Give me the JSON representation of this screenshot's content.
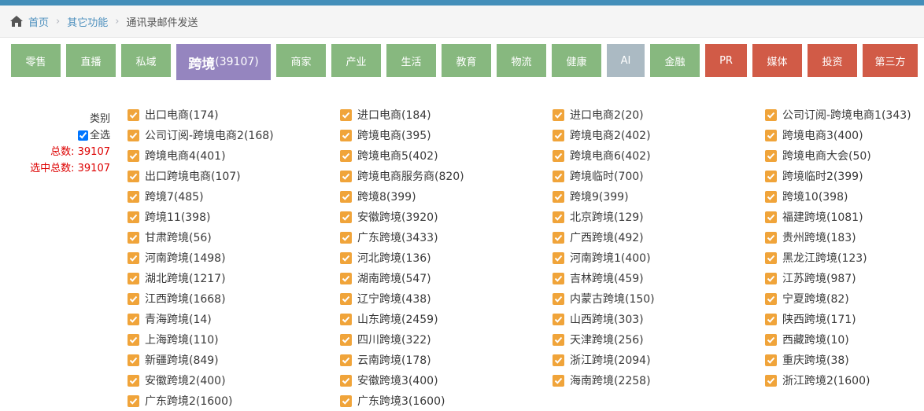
{
  "breadcrumb": {
    "home": "首页",
    "level1": "其它功能",
    "current": "通讯录邮件发送"
  },
  "colors": {
    "green": "#87b87f",
    "purple": "#9585bf",
    "gray": "#abbac3",
    "red": "#d15b47",
    "checkbox": "#f0a43a",
    "topbar": "#438eb9"
  },
  "tabs": [
    {
      "label": "零售",
      "color": "green",
      "w": 63
    },
    {
      "label": "直播",
      "color": "green",
      "w": 63
    },
    {
      "label": "私域",
      "color": "green",
      "w": 63
    },
    {
      "label": "跨境",
      "count": "(39107)",
      "color": "purple",
      "active": true,
      "w": 120
    },
    {
      "label": "商家",
      "color": "green",
      "w": 63
    },
    {
      "label": "产业",
      "color": "green",
      "w": 63
    },
    {
      "label": "生活",
      "color": "green",
      "w": 63
    },
    {
      "label": "教育",
      "color": "green",
      "w": 63
    },
    {
      "label": "物流",
      "color": "green",
      "w": 63
    },
    {
      "label": "健康",
      "color": "green",
      "w": 63
    },
    {
      "label": "AI",
      "color": "gray",
      "w": 48
    },
    {
      "label": "金融",
      "color": "green",
      "w": 63
    },
    {
      "label": "PR",
      "color": "red",
      "w": 53
    },
    {
      "label": "媒体",
      "color": "red",
      "w": 63
    },
    {
      "label": "投资",
      "color": "red",
      "w": 63
    },
    {
      "label": "第三方",
      "color": "red",
      "w": 70
    }
  ],
  "side": {
    "category_label": "类别",
    "select_all_label": "全选",
    "total_label": "总数:",
    "total_value": "39107",
    "selected_label": "选中总数:",
    "selected_value": "39107"
  },
  "items": [
    "出口电商(174)",
    "进口电商(184)",
    "进口电商2(20)",
    "公司订阅-跨境电商1(343)",
    "公司订阅-跨境电商2(168)",
    "跨境电商(395)",
    "跨境电商2(402)",
    "跨境电商3(400)",
    "跨境电商4(401)",
    "跨境电商5(402)",
    "跨境电商6(402)",
    "跨境电商大会(50)",
    "出口跨境电商(107)",
    "跨境电商服务商(820)",
    "跨境临时(700)",
    "跨境临时2(399)",
    "跨境7(485)",
    "跨境8(399)",
    "跨境9(399)",
    "跨境10(398)",
    "跨境11(398)",
    "安徽跨境(3920)",
    "北京跨境(129)",
    "福建跨境(1081)",
    "甘肃跨境(56)",
    "广东跨境(3433)",
    "广西跨境(492)",
    "贵州跨境(183)",
    "河南跨境(1498)",
    "河北跨境(136)",
    "河南跨境1(400)",
    "黑龙江跨境(123)",
    "湖北跨境(1217)",
    "湖南跨境(547)",
    "吉林跨境(459)",
    "江苏跨境(987)",
    "江西跨境(1668)",
    "辽宁跨境(438)",
    "内蒙古跨境(150)",
    "宁夏跨境(82)",
    "青海跨境(14)",
    "山东跨境(2459)",
    "山西跨境(303)",
    "陕西跨境(171)",
    "上海跨境(110)",
    "四川跨境(322)",
    "天津跨境(256)",
    "西藏跨境(10)",
    "新疆跨境(849)",
    "云南跨境(178)",
    "浙江跨境(2094)",
    "重庆跨境(38)",
    "安徽跨境2(400)",
    "安徽跨境3(400)",
    "海南跨境(2258)",
    "浙江跨境2(1600)",
    "广东跨境2(1600)",
    "广东跨境3(1600)"
  ]
}
